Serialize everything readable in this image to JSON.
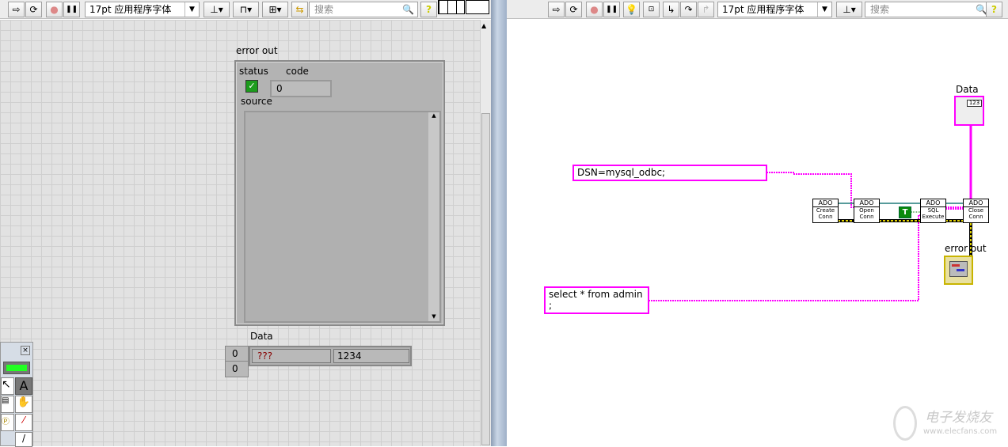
{
  "front_panel": {
    "toolbar": {
      "font": "17pt 应用程序字体",
      "search_placeholder": "搜索",
      "help": "?",
      "run": "⇨",
      "run_cont": "⟳",
      "abort": "●",
      "pause": "❚❚"
    },
    "error_out": {
      "label": "error out",
      "status_label": "status",
      "code_label": "code",
      "code_value": "0",
      "source_label": "source",
      "source_value": ""
    },
    "data_array": {
      "label": "Data",
      "index0": "0",
      "index1": "0",
      "values": [
        "???",
        "1234"
      ]
    }
  },
  "block_diagram": {
    "toolbar": {
      "font": "17pt 应用程序字体",
      "search_placeholder": "搜索",
      "help": "?"
    },
    "dsn_constant": "DSN=mysql_odbc;",
    "sql_constant": "select * from admin ;",
    "bool_constant": "T",
    "nodes": [
      {
        "header": "ADO",
        "line1": "Create",
        "line2": "Conn"
      },
      {
        "header": "ADO",
        "line1": "Open",
        "line2": "Conn"
      },
      {
        "header": "ADO",
        "line1": "SQL",
        "line2": "Execute"
      },
      {
        "header": "ADO",
        "line1": "Close",
        "line2": "Conn"
      }
    ],
    "data_indicator": {
      "label": "Data",
      "type": "123"
    },
    "error_out_indicator": {
      "label": "error out"
    }
  },
  "watermark": {
    "text": "电子发烧友",
    "url": "www.elecfans.com"
  },
  "colors": {
    "string_wire": "#ff00ff",
    "error_wire": "#c8b400",
    "ref_wire": "#1f7a7a",
    "bool": "#008000"
  }
}
